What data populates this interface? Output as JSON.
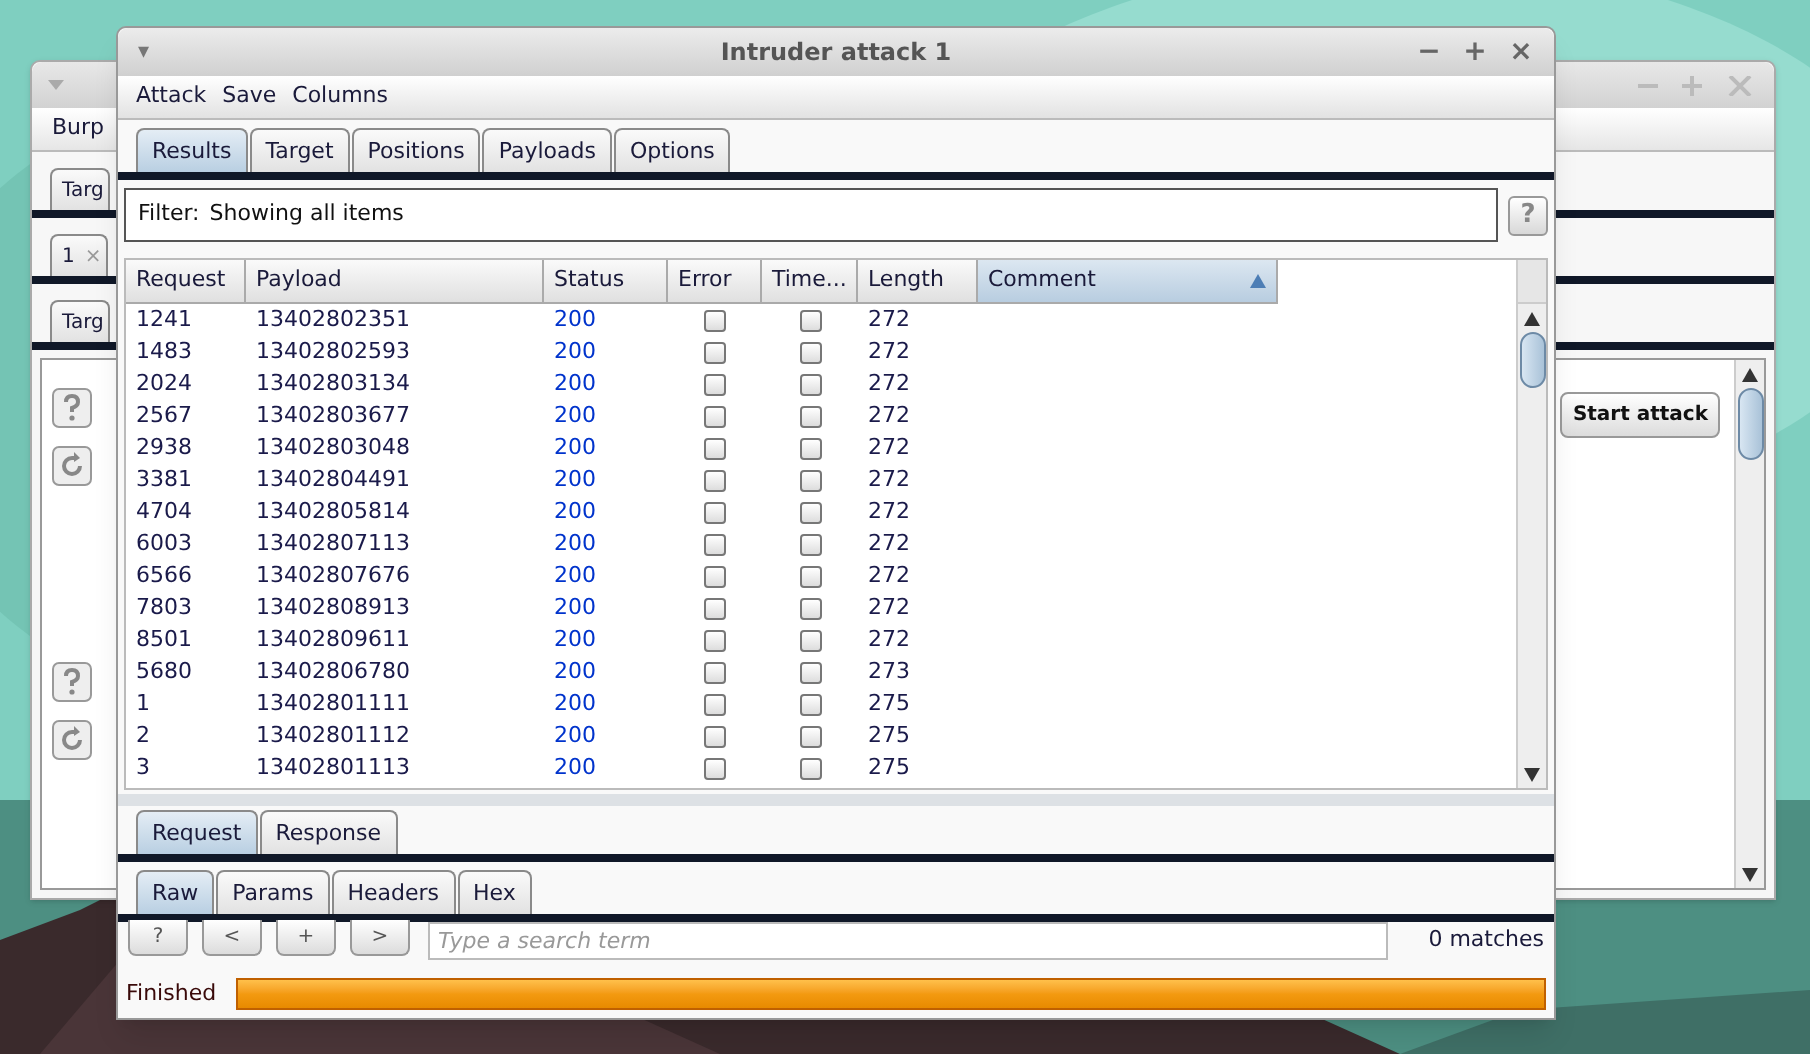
{
  "background_window": {
    "menu": [
      "Burp"
    ],
    "tab_rows": [
      {
        "label": "Targ"
      },
      {
        "label": "1",
        "close": "×"
      },
      {
        "label": "Targ"
      }
    ],
    "start_button": "Start attack"
  },
  "window": {
    "title": "Intruder attack 1",
    "collapse": "▾",
    "controls": [
      "−",
      "+",
      "×"
    ]
  },
  "menu": [
    "Attack",
    "Save",
    "Columns"
  ],
  "tabs": [
    {
      "label": "Results",
      "selected": true
    },
    {
      "label": "Target",
      "selected": false
    },
    {
      "label": "Positions",
      "selected": false
    },
    {
      "label": "Payloads",
      "selected": false
    },
    {
      "label": "Options",
      "selected": false
    }
  ],
  "filter": {
    "label": "Filter:",
    "value": "Showing all items",
    "help": "?"
  },
  "table": {
    "columns": [
      {
        "label": "Request",
        "sorted": false
      },
      {
        "label": "Payload",
        "sorted": false
      },
      {
        "label": "Status",
        "sorted": false
      },
      {
        "label": "Error",
        "sorted": false
      },
      {
        "label": "Time...",
        "sorted": false
      },
      {
        "label": "Length",
        "sorted": false
      },
      {
        "label": "Comment",
        "sorted": true
      }
    ],
    "rows": [
      {
        "request": "1241",
        "payload": "13402802351",
        "status": "200",
        "error": false,
        "timeout": false,
        "length": "272"
      },
      {
        "request": "1483",
        "payload": "13402802593",
        "status": "200",
        "error": false,
        "timeout": false,
        "length": "272"
      },
      {
        "request": "2024",
        "payload": "13402803134",
        "status": "200",
        "error": false,
        "timeout": false,
        "length": "272"
      },
      {
        "request": "2567",
        "payload": "13402803677",
        "status": "200",
        "error": false,
        "timeout": false,
        "length": "272"
      },
      {
        "request": "2938",
        "payload": "13402803048",
        "status": "200",
        "error": false,
        "timeout": false,
        "length": "272"
      },
      {
        "request": "3381",
        "payload": "13402804491",
        "status": "200",
        "error": false,
        "timeout": false,
        "length": "272"
      },
      {
        "request": "4704",
        "payload": "13402805814",
        "status": "200",
        "error": false,
        "timeout": false,
        "length": "272"
      },
      {
        "request": "6003",
        "payload": "13402807113",
        "status": "200",
        "error": false,
        "timeout": false,
        "length": "272"
      },
      {
        "request": "6566",
        "payload": "13402807676",
        "status": "200",
        "error": false,
        "timeout": false,
        "length": "272"
      },
      {
        "request": "7803",
        "payload": "13402808913",
        "status": "200",
        "error": false,
        "timeout": false,
        "length": "272"
      },
      {
        "request": "8501",
        "payload": "13402809611",
        "status": "200",
        "error": false,
        "timeout": false,
        "length": "272"
      },
      {
        "request": "5680",
        "payload": "13402806780",
        "status": "200",
        "error": false,
        "timeout": false,
        "length": "273"
      },
      {
        "request": "1",
        "payload": "13402801111",
        "status": "200",
        "error": false,
        "timeout": false,
        "length": "275"
      },
      {
        "request": "2",
        "payload": "13402801112",
        "status": "200",
        "error": false,
        "timeout": false,
        "length": "275"
      },
      {
        "request": "3",
        "payload": "13402801113",
        "status": "200",
        "error": false,
        "timeout": false,
        "length": "275"
      }
    ]
  },
  "message_tabs": [
    {
      "label": "Request",
      "selected": true
    },
    {
      "label": "Response",
      "selected": false
    }
  ],
  "view_tabs": [
    {
      "label": "Raw",
      "selected": true
    },
    {
      "label": "Params",
      "selected": false
    },
    {
      "label": "Headers",
      "selected": false
    },
    {
      "label": "Hex",
      "selected": false
    }
  ],
  "search": {
    "buttons": [
      "?",
      "<",
      "+",
      ">"
    ],
    "placeholder": "Type a search term",
    "matches": "0 matches"
  },
  "status": {
    "text": "Finished",
    "level": 1
  }
}
